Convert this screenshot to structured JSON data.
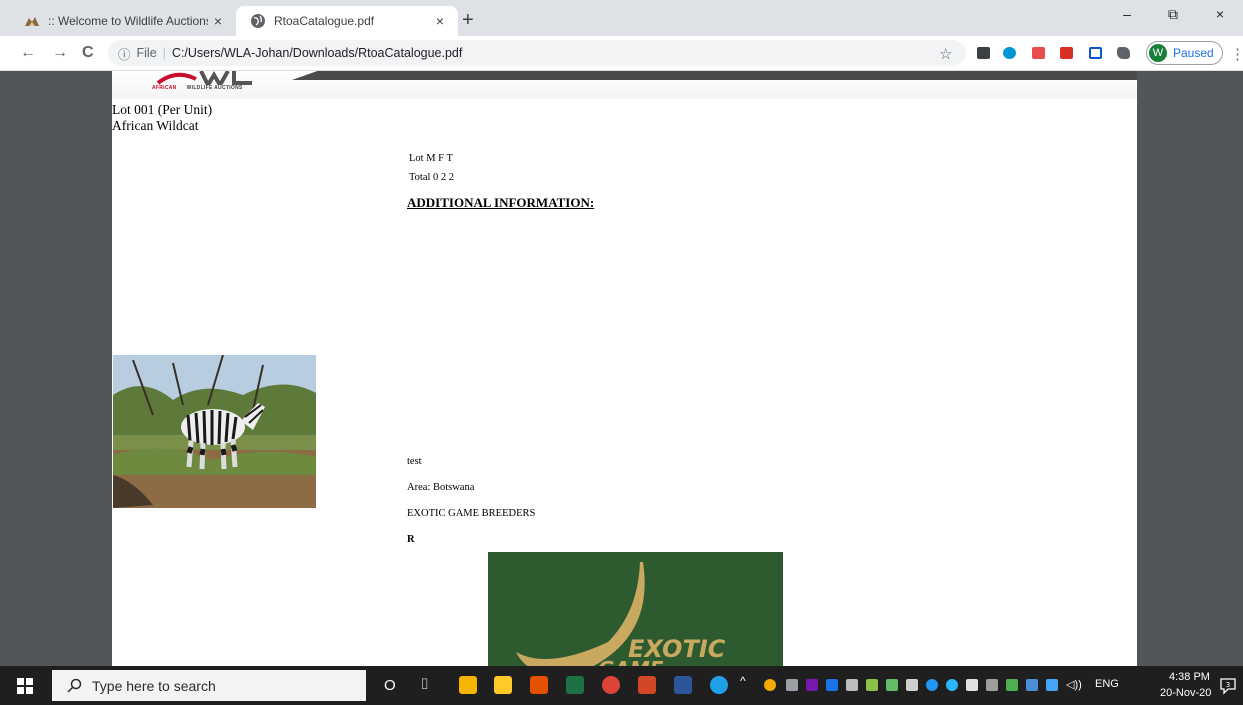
{
  "browser": {
    "tabs": [
      {
        "title": ":: Welcome to Wildlife Auctions ::",
        "close": "×"
      },
      {
        "title": "RtoaCatalogue.pdf",
        "close": "×"
      }
    ],
    "new_tab": "+",
    "window_controls": {
      "minimize": "–",
      "maximize": "⧉",
      "close": "×"
    },
    "nav": {
      "back": "←",
      "forward": "→",
      "reload": "C"
    },
    "address": {
      "info_icon": "ⓘ",
      "scheme": "File",
      "separator": "|",
      "url": "C:/Users/WLA-Johan/Downloads/RtoaCatalogue.pdf"
    },
    "bookmark_icon": "☆",
    "profile": {
      "initial": "W",
      "label": "Paused"
    },
    "menu_icon": "⋮",
    "extensions": [
      "monitor-icon",
      "hp-icon",
      "pdf-icon",
      "pdf-red-icon",
      "pc-icon",
      "puzzle-icon"
    ]
  },
  "document": {
    "logo_text": "AFRICAN",
    "logo_subtext": "WILDLIFE AUCTIONS",
    "lot_line": "Lot 001 (Per Unit)",
    "species": "African Wildcat",
    "table_header": "Lot   M F T",
    "table_total": "Total 0  2 2",
    "additional_info_heading": "ADDITIONAL INFORMATION:",
    "note": "test",
    "area": "Area: Botswana",
    "seller": "EXOTIC GAME BREEDERS",
    "code": "R",
    "sponsor_logo_text": "EXOTIC",
    "sponsor_logo_text2": "GAME"
  },
  "taskbar": {
    "search_placeholder": "Type here to search",
    "cortana_icon": "O",
    "task_view_icon": "⌷",
    "pinned": [
      "outlook-icon",
      "file-explorer-icon",
      "media-icon",
      "excel-icon",
      "chrome-icon",
      "powerpoint-icon",
      "word-icon",
      "edge-icon"
    ],
    "tray_expand": "^",
    "language": "ENG",
    "volume": "◁))",
    "time": "4:38 PM",
    "date": "20-Nov-20",
    "notification_count": "3"
  },
  "colors": {
    "tab_bg": "#dee1e6",
    "viewer_bg": "#525659",
    "taskbar_bg": "#1f1f1f",
    "brand_red": "#c8102e",
    "sponsor_green": "#2d5a2f",
    "sponsor_gold": "#c9a860"
  }
}
